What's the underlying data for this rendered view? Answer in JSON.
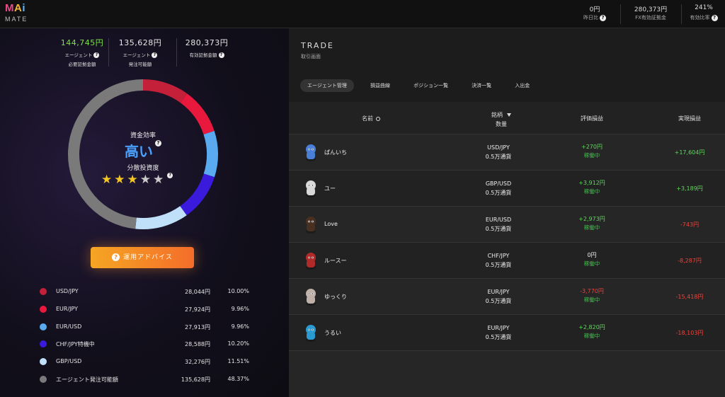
{
  "header": {
    "logo_top": "MAi",
    "logo_bottom": "MATE",
    "stats": [
      {
        "value": "0円",
        "label": "昨日比"
      },
      {
        "value": "280,373円",
        "label": "FX有効証拠金"
      },
      {
        "value": "241%",
        "label": "有効比率"
      }
    ]
  },
  "summary": [
    {
      "value": "144,745円",
      "label1": "エージェント",
      "label2": "必要証拠金額",
      "color": "#7ee04a"
    },
    {
      "value": "135,628円",
      "label1": "エージェント",
      "label2": "発注可能額",
      "color": "#e6e6e6"
    },
    {
      "value": "280,373円",
      "label1": "有効証拠金額",
      "label2": "",
      "color": "#e6e6e6"
    }
  ],
  "efficiency": {
    "label": "資金効率",
    "value": "高い",
    "diversity_label": "分散投資度",
    "stars_filled": 3,
    "stars_total": 5
  },
  "advice_button": "運用アドバイス",
  "allocation": [
    {
      "name": "USD/JPY",
      "amount": "28,044円",
      "percent": "10.00%",
      "pct": 10.0,
      "color": "#c4203a"
    },
    {
      "name": "EUR/JPY",
      "amount": "27,924円",
      "percent": "9.96%",
      "pct": 9.96,
      "color": "#e8193c"
    },
    {
      "name": "EUR/USD",
      "amount": "27,913円",
      "percent": "9.96%",
      "pct": 9.96,
      "color": "#5aaaf0"
    },
    {
      "name": "CHF/JPY特機中",
      "amount": "28,588円",
      "percent": "10.20%",
      "pct": 10.2,
      "color": "#3a1adb"
    },
    {
      "name": "GBP/USD",
      "amount": "32,276円",
      "percent": "11.51%",
      "pct": 11.51,
      "color": "#bfe0f8"
    },
    {
      "name": "エージェント発注可能額",
      "amount": "135,628円",
      "percent": "48.37%",
      "pct": 48.37,
      "color": "#7a7a7a"
    }
  ],
  "trade": {
    "title": "TRADE",
    "subtitle": "取引画面",
    "tabs": [
      "エージェント管理",
      "損益曲線",
      "ポジション一覧",
      "決済一覧",
      "入出金"
    ],
    "columns": {
      "name": "名前",
      "pair_line1": "銘柄",
      "pair_line2": "数量",
      "eval": "評価損益",
      "realized": "実現損益"
    },
    "agents": [
      {
        "name": "ぱんいち",
        "pair": "USD/JPY",
        "qty": "0.5万通貨",
        "eval": "+270円",
        "status": "稼働中",
        "eval_sign": "pos",
        "realized": "+17,604円",
        "real_sign": "pos",
        "avatar_color": "#4a7fd8"
      },
      {
        "name": "ユー",
        "pair": "GBP/USD",
        "qty": "0.5万通貨",
        "eval": "+3,912円",
        "status": "稼働中",
        "eval_sign": "pos",
        "realized": "+3,189円",
        "real_sign": "pos",
        "avatar_color": "#d8d8d8"
      },
      {
        "name": "Love",
        "pair": "EUR/USD",
        "qty": "0.5万通貨",
        "eval": "+2,973円",
        "status": "稼働中",
        "eval_sign": "pos",
        "realized": "-743円",
        "real_sign": "neg",
        "avatar_color": "#4a3020"
      },
      {
        "name": "ルースー",
        "pair": "CHF/JPY",
        "qty": "0.5万通貨",
        "eval": "0円",
        "status": "稼働中",
        "eval_sign": "zero",
        "realized": "-8,287円",
        "real_sign": "neg",
        "avatar_color": "#b02a2a"
      },
      {
        "name": "ゆっくり",
        "pair": "EUR/JPY",
        "qty": "0.5万通貨",
        "eval": "-3,770円",
        "status": "稼働中",
        "eval_sign": "neg",
        "realized": "-15,418円",
        "real_sign": "neg",
        "avatar_color": "#bfb0a8"
      },
      {
        "name": "うるい",
        "pair": "EUR/JPY",
        "qty": "0.5万通貨",
        "eval": "+2,820円",
        "status": "稼働中",
        "eval_sign": "pos",
        "realized": "-18,103円",
        "real_sign": "neg",
        "avatar_color": "#2a9ad0"
      }
    ]
  }
}
